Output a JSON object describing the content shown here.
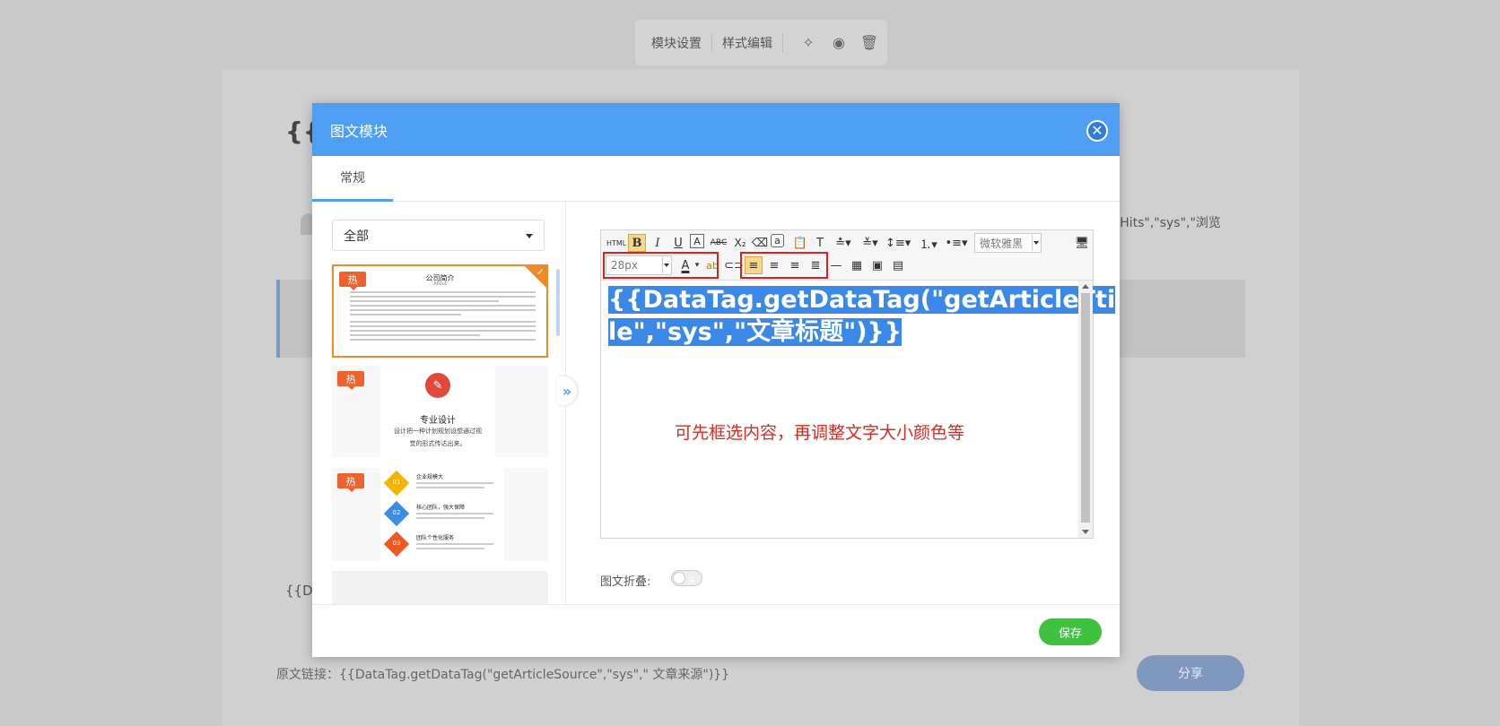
{
  "bg": {
    "toolbar": {
      "module_settings": "模块设置",
      "style_edit": "样式编辑"
    },
    "title_fragment": "{{D",
    "hits_fragment": "cleHits\",\"sys\",\"浏览",
    "datatag_fragment": "{{Da",
    "source_link": "原文链接：{{DataTag.getDataTag(\"getArticleSource\",\"sys\",\" 文章来源\")}}",
    "share_label": "分享"
  },
  "modal": {
    "title": "图文模块",
    "tab_general": "常规",
    "category_select": "全部",
    "templates": {
      "hot_label": "热",
      "t1_title": "公司简介",
      "t1_sub": "About",
      "t2_title": "专业设计",
      "t2_desc1": "设计把一种计划规划设想通过视",
      "t2_desc2": "觉的形式传达出来。",
      "t3_items": [
        {
          "num": "01",
          "title": "企业规模大"
        },
        {
          "num": "02",
          "title": "核心团队，强大保障"
        },
        {
          "num": "03",
          "title": "团队个性化服务"
        }
      ]
    },
    "editor": {
      "html_btn": "HTML",
      "font_family": "微软雅黑",
      "font_size": "28px",
      "content_line1": "{{DataTag.getDataTag(\"getArticleTti",
      "content_line2": "le\",\"sys\",\"文章标题\")}}",
      "hint": "可先框选内容，再调整文字大小颜色等"
    },
    "fold_label": "图文折叠:",
    "toggle_off": "关",
    "save_label": "保存"
  },
  "colors": {
    "header_blue": "#4e9ef3",
    "save_green": "#3fc13f",
    "hot_orange": "#f0622c",
    "annotation_red": "#e02020"
  }
}
